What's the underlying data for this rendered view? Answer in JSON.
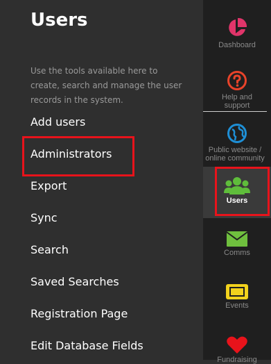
{
  "panel": {
    "title": "Users",
    "description": "Use the tools available here to create, search and manage the user records in the system.",
    "menu": [
      {
        "label": "Add users"
      },
      {
        "label": "Administrators",
        "highlighted": true
      },
      {
        "label": "Export"
      },
      {
        "label": "Sync"
      },
      {
        "label": "Search"
      },
      {
        "label": "Saved Searches"
      },
      {
        "label": "Registration Page"
      },
      {
        "label": "Edit Database Fields"
      }
    ]
  },
  "nav": {
    "items": [
      {
        "label": "Dashboard",
        "icon": "pie-chart-icon",
        "color": "#e0356a"
      },
      {
        "label": "Help and support",
        "icon": "question-icon",
        "color": "#e8432a"
      },
      {
        "label": "Public website / online community",
        "icon": "globe-icon",
        "color": "#1e8fd6"
      },
      {
        "label": "Users",
        "icon": "users-icon",
        "color": "#5fbd3b",
        "active": true
      },
      {
        "label": "Comms",
        "icon": "envelope-icon",
        "color": "#6fbf3e"
      },
      {
        "label": "Events",
        "icon": "ticket-icon",
        "color": "#f2d21d"
      },
      {
        "label": "Fundraising",
        "icon": "heart-icon",
        "color": "#e8131b"
      }
    ]
  },
  "highlight_color": "#e8131b"
}
